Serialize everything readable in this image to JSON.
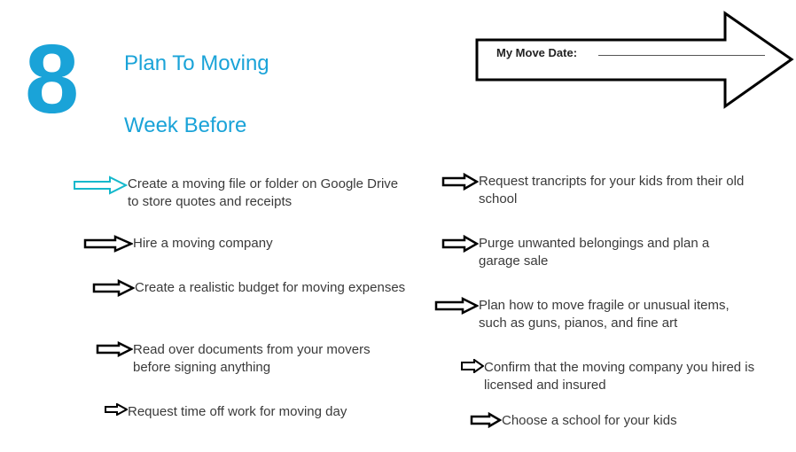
{
  "header": {
    "number": "8",
    "title_line1": "Plan To Moving",
    "title_line2": "Week Before",
    "move_date_label": "My Move Date:"
  },
  "accent_color": "#1aa3d8",
  "left_items": [
    {
      "text": "Create a moving file or folder on Google Drive to store quotes and receipts",
      "highlight": true
    },
    {
      "text": "Hire a moving company",
      "highlight": false
    },
    {
      "text": "Create a realistic budget for moving expenses",
      "highlight": false
    },
    {
      "text": "Read over documents from your movers before signing anything",
      "highlight": false
    },
    {
      "text": "Request time off work for moving day",
      "highlight": false
    }
  ],
  "right_items": [
    {
      "text": "Request trancripts for your kids from their old school",
      "highlight": false
    },
    {
      "text": "Purge unwanted belongings and plan a garage sale",
      "highlight": false
    },
    {
      "text": "Plan how to move fragile or unusual items, such as guns, pianos, and fine art",
      "highlight": false
    },
    {
      "text": "Confirm that the moving company you hired is licensed and insured",
      "highlight": false
    },
    {
      "text": "Choose a school for your kids",
      "highlight": false
    }
  ]
}
